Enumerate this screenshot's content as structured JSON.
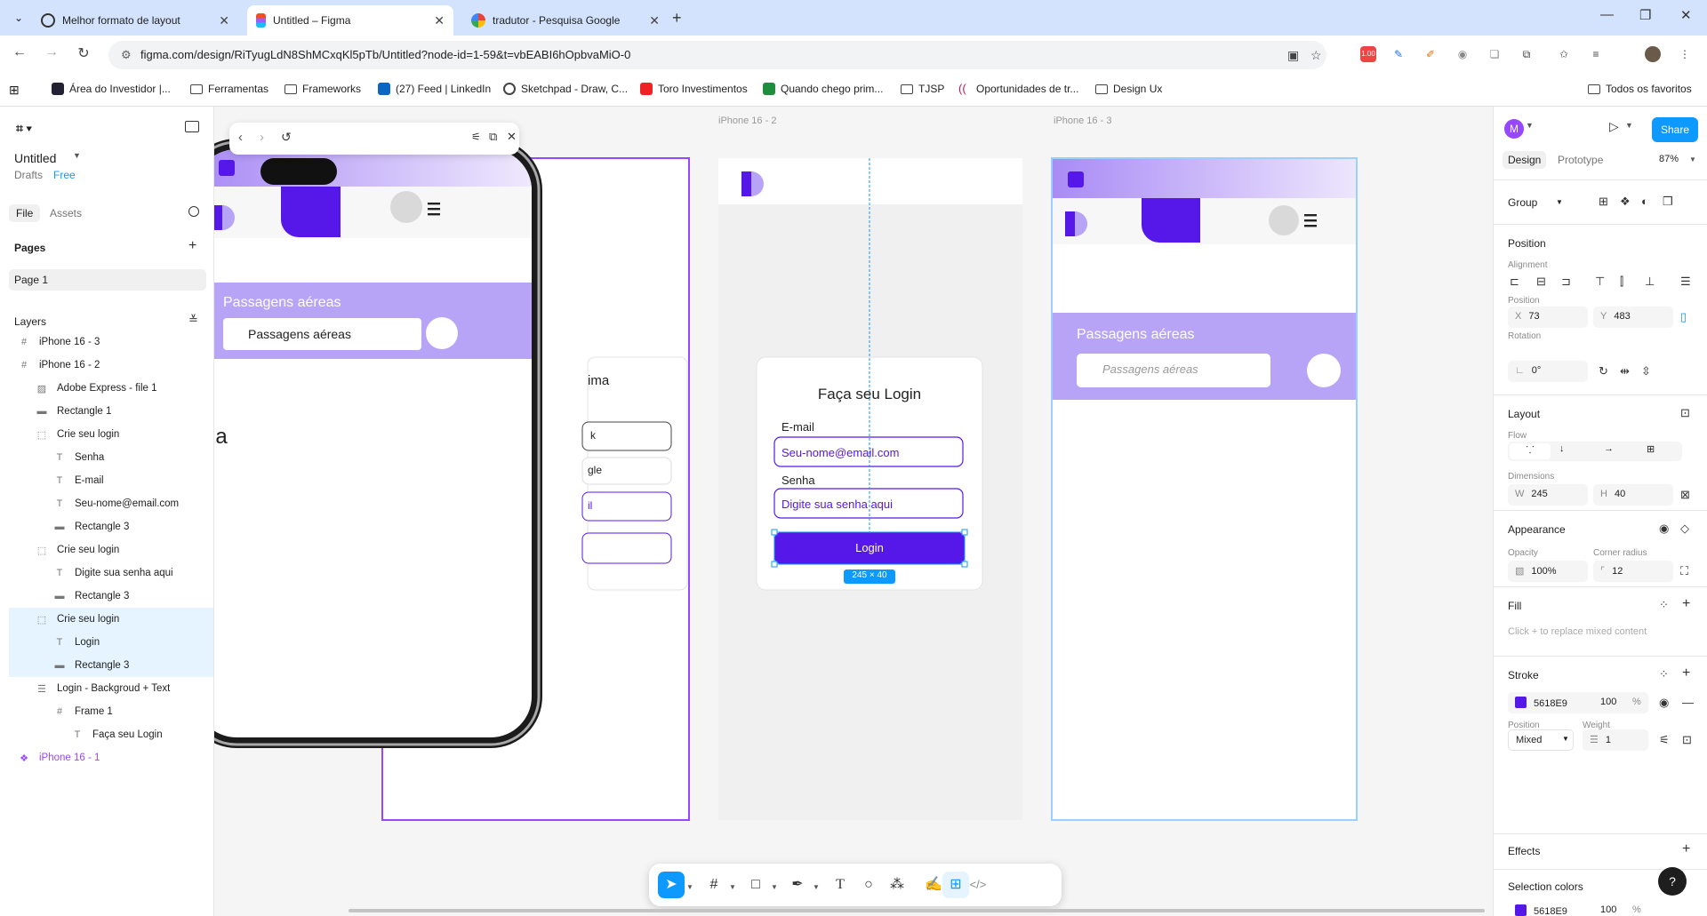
{
  "browser": {
    "tabs": [
      {
        "title": "Melhor formato de layout",
        "favicon": "openai-icon",
        "active": false
      },
      {
        "title": "Untitled – Figma",
        "favicon": "figma-icon",
        "active": true
      },
      {
        "title": "tradutor - Pesquisa Google",
        "favicon": "google-icon",
        "active": false
      }
    ],
    "url": "figma.com/design/RiTyugLdN8ShMCxqKl5pTb/Untitled?node-id=1-59&t=vbEABI6hOpbvaMiO-0",
    "extension_badge": "1.00",
    "bookmarks": [
      "Área do Investidor |...",
      "Ferramentas",
      "Frameworks",
      "(27) Feed | LinkedIn",
      "Sketchpad - Draw, C...",
      "Toro Investimentos",
      "Quando chego prim...",
      "TJSP",
      "Oportunidades de tr...",
      "Design Ux"
    ],
    "bookmarks_right": "Todos os favoritos"
  },
  "left_panel": {
    "file_title": "Untitled",
    "location": "Drafts",
    "plan": "Free",
    "tabs": [
      "File",
      "Assets"
    ],
    "pages_heading": "Pages",
    "pages": [
      "Page 1"
    ],
    "layers_heading": "Layers",
    "layers": [
      {
        "name": "iPhone 16 - 3",
        "icon": "frame-icon",
        "indent": 0
      },
      {
        "name": "iPhone 16 - 2",
        "icon": "frame-icon",
        "indent": 0
      },
      {
        "name": "Adobe Express - file 1",
        "icon": "image-icon",
        "indent": 1
      },
      {
        "name": "Rectangle 1",
        "icon": "rectangle-icon",
        "indent": 1
      },
      {
        "name": "Crie seu login",
        "icon": "group-icon",
        "indent": 1
      },
      {
        "name": "Senha",
        "icon": "text-icon",
        "indent": 2
      },
      {
        "name": "E-mail",
        "icon": "text-icon",
        "indent": 2
      },
      {
        "name": "Seu-nome@email.com",
        "icon": "text-icon",
        "indent": 2
      },
      {
        "name": "Rectangle 3",
        "icon": "rectangle-icon",
        "indent": 2
      },
      {
        "name": "Crie seu login",
        "icon": "group-icon",
        "indent": 1
      },
      {
        "name": "Digite sua senha aqui",
        "icon": "text-icon",
        "indent": 2
      },
      {
        "name": "Rectangle 3",
        "icon": "rectangle-icon",
        "indent": 2
      },
      {
        "name": "Crie seu login",
        "icon": "group-icon",
        "indent": 1,
        "selected": true
      },
      {
        "name": "Login",
        "icon": "text-icon",
        "indent": 2,
        "selected": true
      },
      {
        "name": "Rectangle 3",
        "icon": "rectangle-icon",
        "indent": 2,
        "selected": true
      },
      {
        "name": "Login - Backgroud + Text",
        "icon": "autolayout-icon",
        "indent": 1
      },
      {
        "name": "Frame 1",
        "icon": "frame-icon",
        "indent": 2
      },
      {
        "name": "Faça seu Login",
        "icon": "text-icon",
        "indent": 3
      },
      {
        "name": "iPhone 16 - 1",
        "icon": "component-icon",
        "indent": 0,
        "component": true
      }
    ]
  },
  "canvas": {
    "frame_labels": [
      "iPhone 16 - 2",
      "iPhone 16 - 3"
    ],
    "login_card": {
      "title": "Faça seu Login",
      "email_label": "E-mail",
      "email_placeholder": "Seu-nome@email.com",
      "password_label": "Senha",
      "password_placeholder": "Digite sua senha aqui",
      "button": "Login",
      "size_badge": "245 × 40"
    },
    "partial_card": {
      "title_fragment": "ima",
      "row1": "k",
      "row2": "gle",
      "row3": "il"
    },
    "stray_text": "ia",
    "banner_title": "Passagens aéreas",
    "search_placeholder": "Passagens aéreas",
    "phone_search_value": "Passagens aéreas"
  },
  "right_panel": {
    "avatar_initial": "M",
    "share": "Share",
    "tabs": [
      "Design",
      "Prototype"
    ],
    "zoom": "87%",
    "group_label": "Group",
    "position": {
      "heading": "Position",
      "alignment_label": "Alignment",
      "position_label": "Position",
      "x": "73",
      "y": "483",
      "rotation_label": "Rotation",
      "rotation": "0°"
    },
    "layout": {
      "heading": "Layout",
      "flow_label": "Flow",
      "dimensions_label": "Dimensions",
      "w": "245",
      "h": "40"
    },
    "appearance": {
      "heading": "Appearance",
      "opacity_label": "Opacity",
      "opacity": "100%",
      "radius_label": "Corner radius",
      "radius": "12"
    },
    "fill": {
      "heading": "Fill",
      "hint": "Click + to replace mixed content"
    },
    "stroke": {
      "heading": "Stroke",
      "color": "5618E9",
      "opacity": "100",
      "unit": "%",
      "position_label": "Position",
      "position": "Mixed",
      "weight_label": "Weight",
      "weight": "1"
    },
    "effects": {
      "heading": "Effects"
    },
    "selection_colors": {
      "heading": "Selection colors",
      "color": "5618E9",
      "opacity": "100",
      "unit": "%"
    },
    "help": "?"
  },
  "colors": {
    "brand": "#5618e9",
    "purple_light": "#b7a4f7",
    "figma_blue": "#0d99ff"
  }
}
